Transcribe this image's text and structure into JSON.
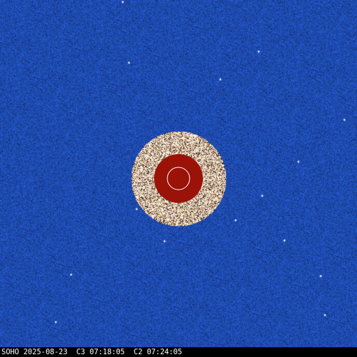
{
  "image": {
    "caption": "SOHO 2025-08-23  C3 07:18:05  C2 07:24:05",
    "colors": {
      "background_blue": "#1f4db0",
      "occulter_red": "#9a1208",
      "sun_outline": "#ffffff",
      "inner_ring_light": "#f1e6d6",
      "inner_ring_dark": "#3a2414",
      "caption_text": "#ffffff",
      "caption_bar": "#000000"
    }
  }
}
